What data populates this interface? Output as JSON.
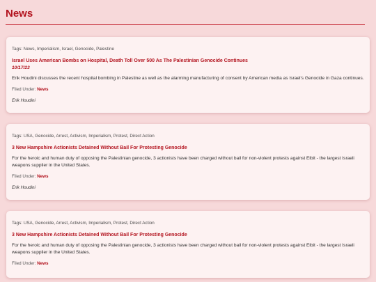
{
  "page": {
    "title": "News",
    "accent_color": "#b3141f",
    "background_color": "#f7d9da"
  },
  "posts": [
    {
      "tags": "Tags: News, Imperialism, Israel, Genocide, Palestine",
      "title": "Israel Uses American Bombs on Hospital, Death Toll Over 500 As The Palestinian Genocide Continues",
      "date": "10/17/23",
      "excerpt": "Erik Houdini discusses the recent hospital bombing in Palestine as well as the alarming manufacturing of consent by American media as Israel's Genocide in Gaza continues.",
      "filed_label": "Filed Under:",
      "category": "News",
      "author": "Erik Houdini"
    },
    {
      "tags": "Tags: USA, Genocide, Arrest, Activism, Imperialism, Protest, Direct Action",
      "title": "3 New Hampshire Actionists Detained Without Bail For Protesting Genocide",
      "date": "",
      "excerpt": "For the heroic and human duty of opposing the Palestinian genocide, 3 actionists have been charged without bail for non-violent protests against Elbit - the largest Israeli weapons supplier in the United States.",
      "filed_label": "Filed Under:",
      "category": "News",
      "author": "Erik Houdini"
    },
    {
      "tags": "Tags: USA, Genocide, Arrest, Activism, Imperialism, Protest, Direct Action",
      "title": "3 New Hampshire Actionists Detained Without Bail For Protesting Genocide",
      "date": "",
      "excerpt": "For the heroic and human duty of opposing the Palestinian genocide, 3 actionists have been charged without bail for non-violent protests against Elbit - the largest Israeli weapons supplier in the United States.",
      "filed_label": "Filed Under:",
      "category": "News",
      "author": ""
    }
  ]
}
